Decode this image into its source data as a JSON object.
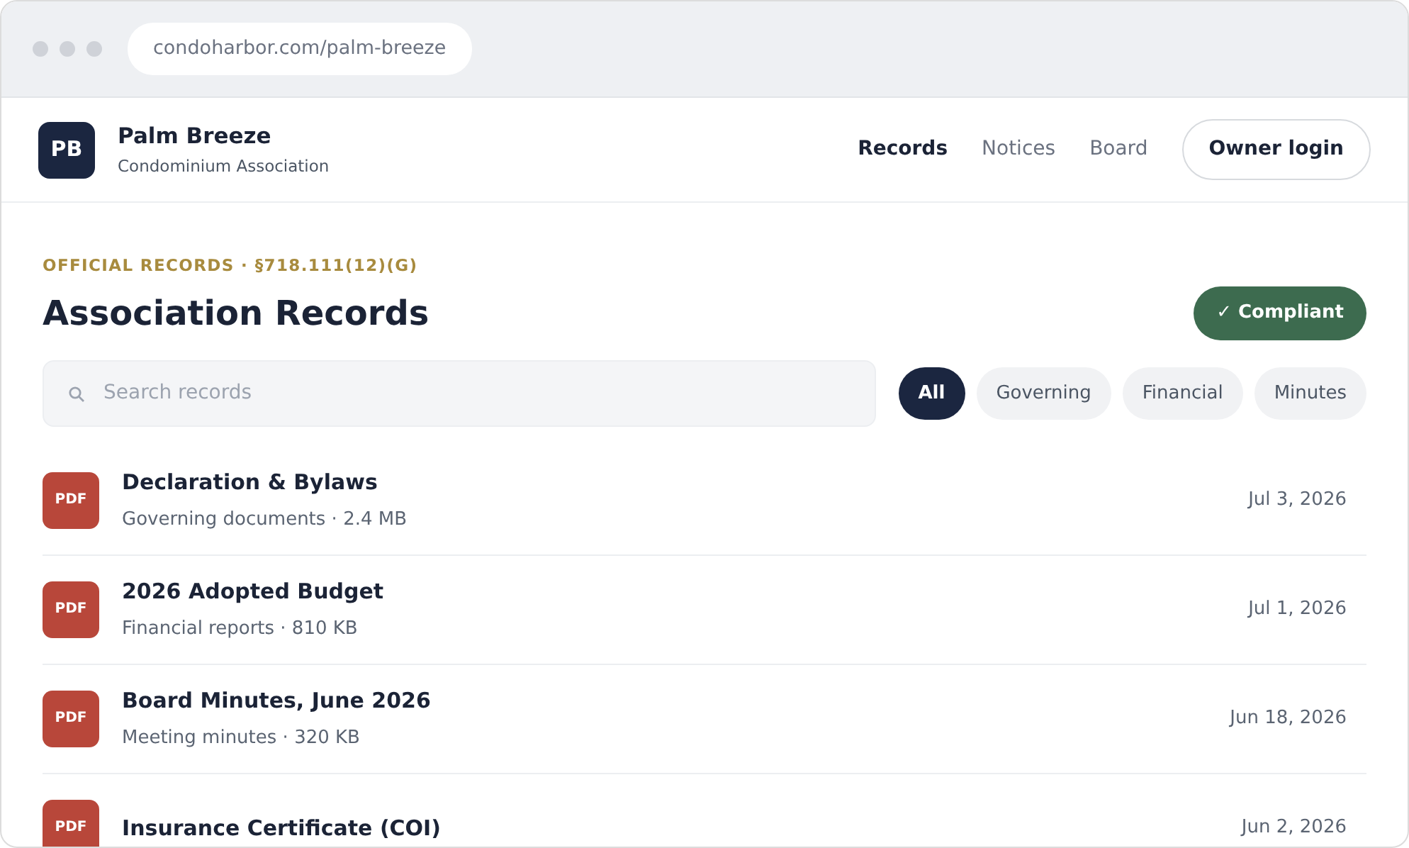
{
  "browser": {
    "url": "condoharbor.com/palm-breeze"
  },
  "header": {
    "logo": "PB",
    "name": "Palm Breeze",
    "subtitle": "Condominium Association",
    "nav": [
      {
        "label": "Records",
        "selected": true
      },
      {
        "label": "Notices",
        "selected": false
      },
      {
        "label": "Board",
        "selected": false
      }
    ],
    "login_button": "Owner login"
  },
  "eyebrow": "OFFICIAL RECORDS · §718.111(12)(G)",
  "title": "Association Records",
  "status_badge": "✓ Compliant",
  "search": {
    "placeholder": "Search records"
  },
  "filters": [
    {
      "label": "All",
      "selected": true
    },
    {
      "label": "Governing",
      "selected": false
    },
    {
      "label": "Financial",
      "selected": false
    },
    {
      "label": "Minutes",
      "selected": false
    }
  ],
  "records": [
    {
      "type": "PDF",
      "title": "Declaration & Bylaws",
      "meta": "Governing documents · 2.4 MB",
      "date": "Jul 3, 2026"
    },
    {
      "type": "PDF",
      "title": "2026 Adopted Budget",
      "meta": "Financial reports · 810 KB",
      "date": "Jul 1, 2026"
    },
    {
      "type": "PDF",
      "title": "Board Minutes, June 2026",
      "meta": "Meeting minutes · 320 KB",
      "date": "Jun 18, 2026"
    },
    {
      "type": "PDF",
      "title": "Insurance Certificate (COI)",
      "date": "Jun 2, 2026"
    }
  ]
}
